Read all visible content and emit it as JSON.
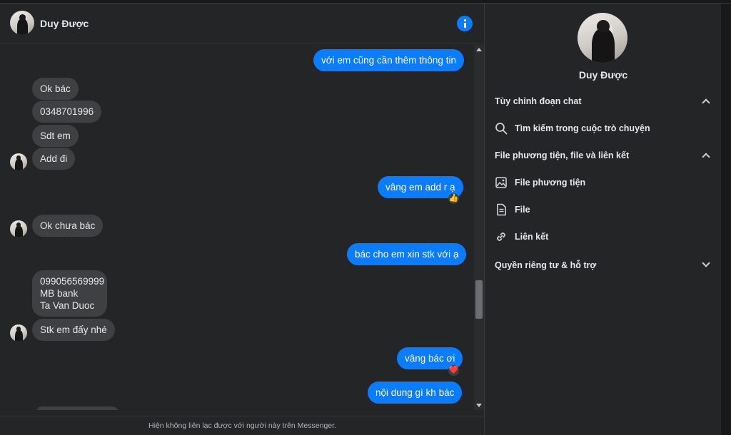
{
  "contact": {
    "name": "Duy Được"
  },
  "colors": {
    "accent": "#0a7cff",
    "incoming_bubble": "#3e4042",
    "background": "#242526"
  },
  "messages": [
    {
      "dir": "out",
      "text": "với em cũng cần thêm thông tin"
    },
    {
      "dir": "in",
      "text": "Ok bác"
    },
    {
      "dir": "in",
      "text": "0348701996"
    },
    {
      "dir": "in",
      "text": "Sdt em"
    },
    {
      "dir": "in",
      "text": "Add đi",
      "avatar": true
    },
    {
      "dir": "out",
      "text": "vâng em add r ạ",
      "reaction": "👍"
    },
    {
      "dir": "in",
      "text": "Ok chưa bác",
      "avatar": true
    },
    {
      "dir": "out",
      "text": "bác cho em xin stk với ạ"
    },
    {
      "dir": "in",
      "lines": [
        "099056569999",
        "MB bank",
        "Ta Van Duoc"
      ]
    },
    {
      "dir": "in",
      "text": "Stk em đấy nhé",
      "avatar": true
    },
    {
      "dir": "out",
      "text": "vâng bác ơi",
      "reaction": "❤️"
    },
    {
      "dir": "out",
      "text": "nội dung gì kh bác"
    }
  ],
  "footer_notice": "Hiện không liên lạc được với người này trên Messenger.",
  "sidebar": {
    "name": "Duy Được",
    "sections": [
      {
        "title": "Tùy chỉnh đoạn chat",
        "expanded": true
      },
      {
        "title": "File phương tiện, file và liên kết",
        "expanded": true
      },
      {
        "title": "Quyền riêng tư & hỗ trợ",
        "expanded": false
      }
    ],
    "items": [
      {
        "label": "Tìm kiếm trong cuộc trò chuyện",
        "icon": "search-icon"
      },
      {
        "label": "File phương tiện",
        "icon": "media-icon"
      },
      {
        "label": "File",
        "icon": "file-icon"
      },
      {
        "label": "Liên kết",
        "icon": "link-icon"
      }
    ]
  }
}
